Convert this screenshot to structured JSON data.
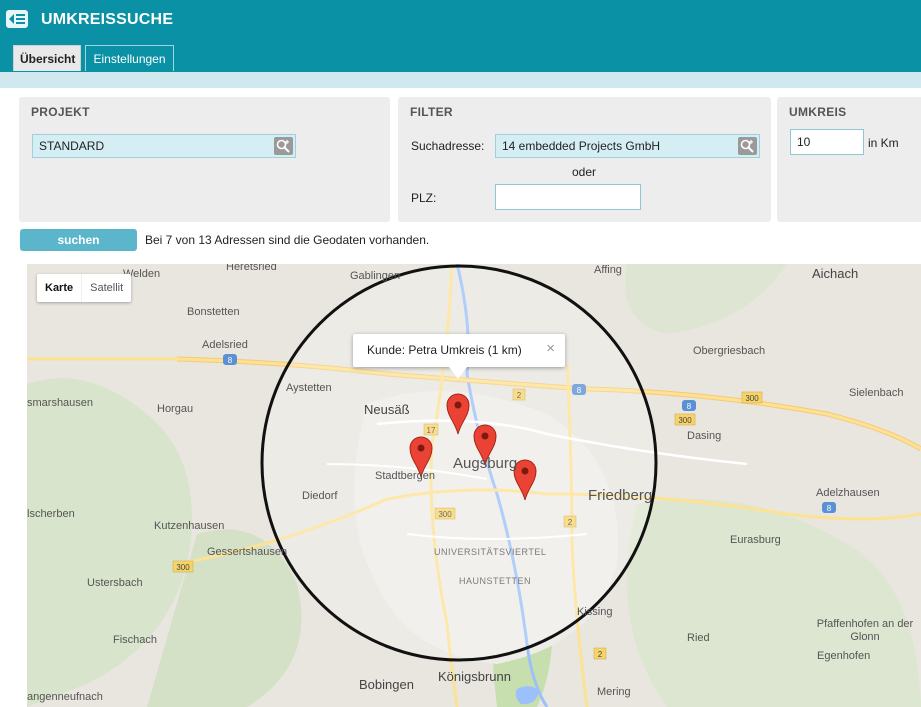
{
  "header": {
    "title": "UMKREISSUCHE",
    "back_icon": "back-menu-icon"
  },
  "tabs": [
    {
      "label": "Übersicht",
      "active": true
    },
    {
      "label": "Einstellungen",
      "active": false
    }
  ],
  "projekt": {
    "heading": "PROJEKT",
    "value": "STANDARD"
  },
  "filter": {
    "heading": "FILTER",
    "suchadresse_label": "Suchadresse:",
    "suchadresse_value": "14 embedded Projects GmbH",
    "oder": "oder",
    "plz_label": "PLZ:",
    "plz_value": ""
  },
  "umkreis": {
    "heading": "UMKREIS",
    "value": "10",
    "unit": "in Km"
  },
  "actions": {
    "search_label": "suchen",
    "status": "Bei 7 von 13 Adressen sind die Geodaten vorhanden."
  },
  "map": {
    "maptype": {
      "map_label": "Karte",
      "satellite_label": "Satellit"
    },
    "infowindow": {
      "text": "Kunde: Petra Umkreis (1 km)",
      "close": "×"
    },
    "places": [
      "Welden",
      "Heretsried",
      "Gablingen",
      "Affing",
      "Aichach",
      "Bonstetten",
      "Adelsried",
      "Obergriesbach",
      "Aystetten",
      "Sielenbach",
      "smarshausen",
      "Horgau",
      "Neusäß",
      "Dasing",
      "Augsburg",
      "Stadtbergen",
      "Friedberg",
      "Diedorf",
      "Adelzhausen",
      "lscherben",
      "Kutzenhausen",
      "Eurasburg",
      "Gessertshausen",
      "UNIVERSITÄTSVIERTEL",
      "HAUNSTETTEN",
      "Ustersbach",
      "Kissing",
      "Pfaffenhofen an der Glonn",
      "Fischach",
      "Ried",
      "Egenhofen",
      "Bobingen",
      "Königsbrunn",
      "angenneufnach",
      "Mering"
    ],
    "road_labels": [
      "8",
      "8",
      "8",
      "8",
      "300",
      "300",
      "300",
      "300",
      "17",
      "2",
      "2",
      "2"
    ]
  }
}
